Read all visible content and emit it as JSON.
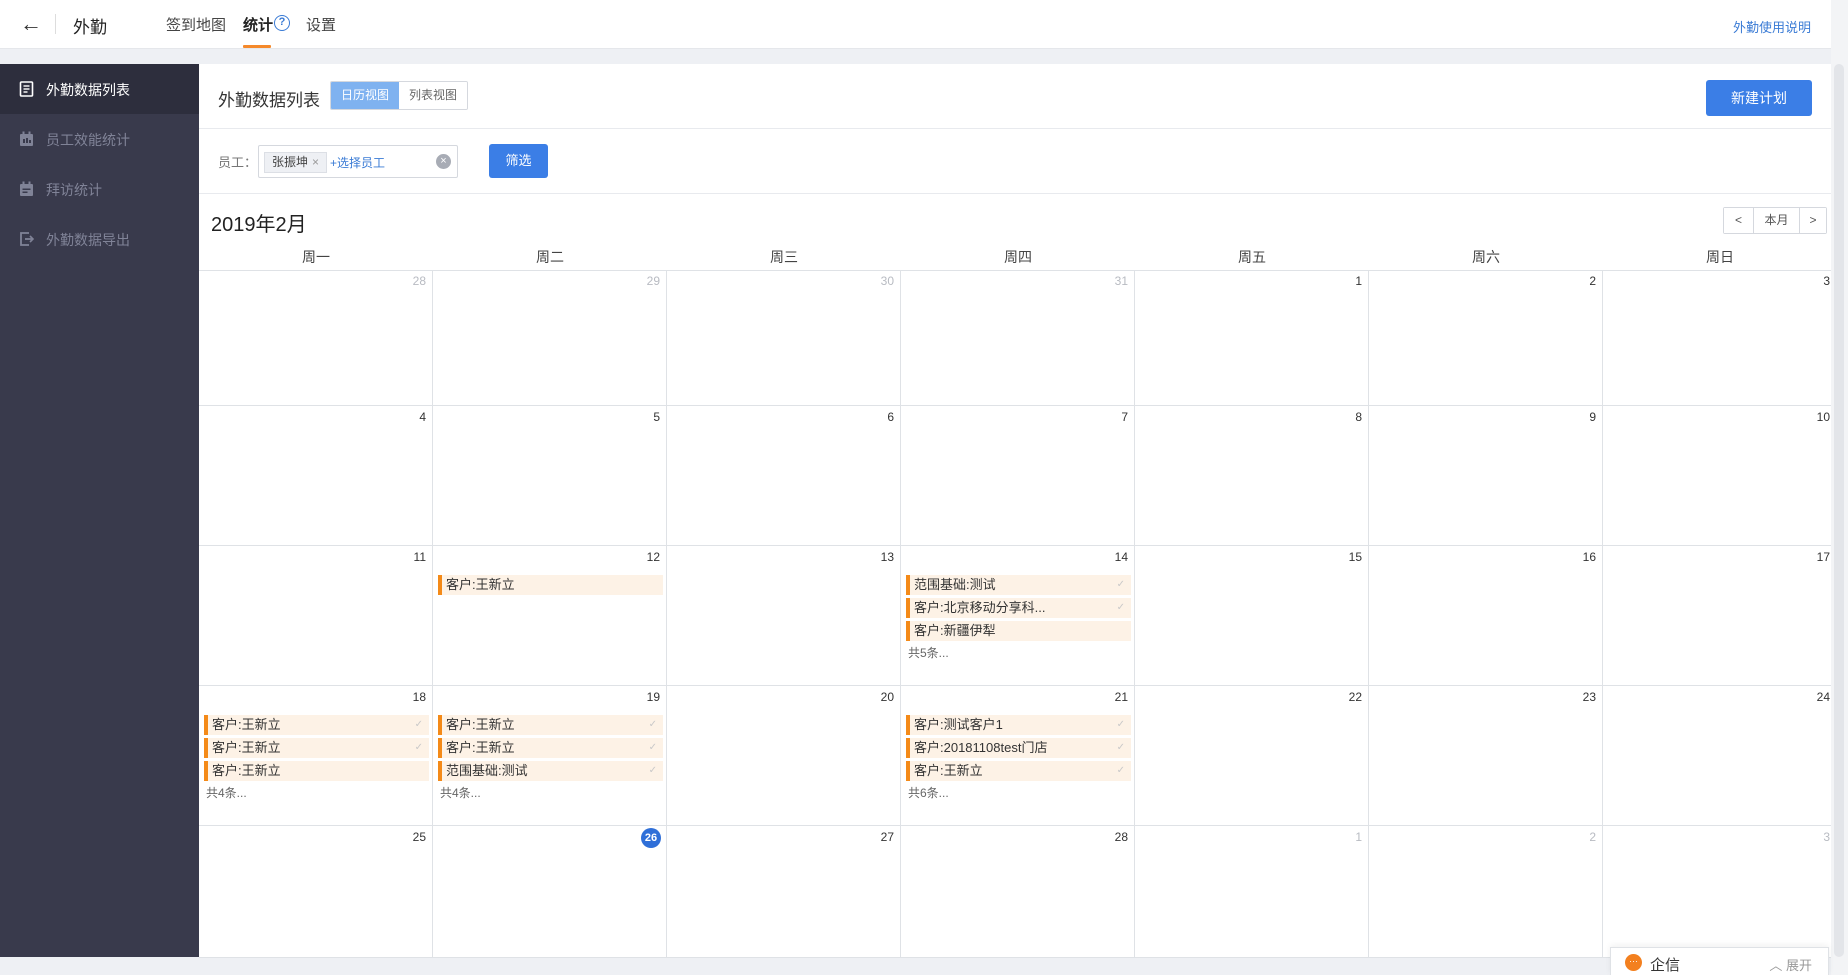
{
  "topbar": {
    "app_title": "外勤",
    "tabs": [
      {
        "label": "签到地图"
      },
      {
        "label": "统计"
      },
      {
        "label": "设置"
      }
    ],
    "help_glyph": "?",
    "help_link": "外勤使用说明"
  },
  "sidebar": {
    "items": [
      {
        "label": "外勤数据列表",
        "icon": "list-icon",
        "active": true
      },
      {
        "label": "员工效能统计",
        "icon": "calendar-stats-icon",
        "active": false
      },
      {
        "label": "拜访统计",
        "icon": "calendar-icon",
        "active": false
      },
      {
        "label": "外勤数据导出",
        "icon": "export-icon",
        "active": false
      }
    ]
  },
  "main": {
    "title": "外勤数据列表",
    "views": {
      "calendar": "日历视图",
      "list": "列表视图"
    },
    "new_plan": "新建计划",
    "filter": {
      "employee_label": "员工：",
      "employee_tag": "张振坤",
      "tag_remove": "×",
      "add_employee": "+选择员工",
      "clear_glyph": "×",
      "filter_button": "筛选"
    },
    "month_title": "2019年2月",
    "nav": {
      "prev": "<",
      "current": "本月",
      "next": ">"
    }
  },
  "calendar": {
    "weekdays": [
      "周一",
      "周二",
      "周三",
      "周四",
      "周五",
      "周六",
      "周日"
    ],
    "check_glyph": "✓",
    "weeks": [
      [
        {
          "day": "28",
          "other": true
        },
        {
          "day": "29",
          "other": true
        },
        {
          "day": "30",
          "other": true
        },
        {
          "day": "31",
          "other": true
        },
        {
          "day": "1"
        },
        {
          "day": "2"
        },
        {
          "day": "3"
        }
      ],
      [
        {
          "day": "4"
        },
        {
          "day": "5"
        },
        {
          "day": "6"
        },
        {
          "day": "7"
        },
        {
          "day": "8"
        },
        {
          "day": "9"
        },
        {
          "day": "10"
        }
      ],
      [
        {
          "day": "11"
        },
        {
          "day": "12",
          "events": [
            {
              "text": "客户:王新立",
              "checked": false
            }
          ]
        },
        {
          "day": "13"
        },
        {
          "day": "14",
          "events": [
            {
              "text": "范围基础:测试",
              "checked": true
            },
            {
              "text": "客户:北京移动分享科...",
              "checked": true
            },
            {
              "text": "客户:新疆伊犁",
              "checked": false
            }
          ],
          "more": "共5条..."
        },
        {
          "day": "15"
        },
        {
          "day": "16"
        },
        {
          "day": "17"
        }
      ],
      [
        {
          "day": "18",
          "events": [
            {
              "text": "客户:王新立",
              "checked": true
            },
            {
              "text": "客户:王新立",
              "checked": true
            },
            {
              "text": "客户:王新立",
              "checked": false
            }
          ],
          "more": "共4条..."
        },
        {
          "day": "19",
          "events": [
            {
              "text": "客户:王新立",
              "checked": true
            },
            {
              "text": "客户:王新立",
              "checked": true
            },
            {
              "text": "范围基础:测试",
              "checked": true
            }
          ],
          "more": "共4条..."
        },
        {
          "day": "20"
        },
        {
          "day": "21",
          "events": [
            {
              "text": "客户:测试客户1",
              "checked": true
            },
            {
              "text": "客户:20181108test门店",
              "checked": true
            },
            {
              "text": "客户:王新立",
              "checked": true
            }
          ],
          "more": "共6条..."
        },
        {
          "day": "22"
        },
        {
          "day": "23"
        },
        {
          "day": "24"
        }
      ],
      [
        {
          "day": "25"
        },
        {
          "day": "26",
          "today": true
        },
        {
          "day": "27"
        },
        {
          "day": "28"
        },
        {
          "day": "1",
          "other": true
        },
        {
          "day": "2",
          "other": true
        },
        {
          "day": "3",
          "other": true
        }
      ]
    ]
  },
  "chat": {
    "label": "企信",
    "expand": "︿ 展开",
    "icon_glyph": "···"
  },
  "colors": {
    "accent": "#3b7ee6",
    "event_bar": "#f48a18",
    "event_bg": "#fdf2e6",
    "sidebar": "#393a4c"
  }
}
